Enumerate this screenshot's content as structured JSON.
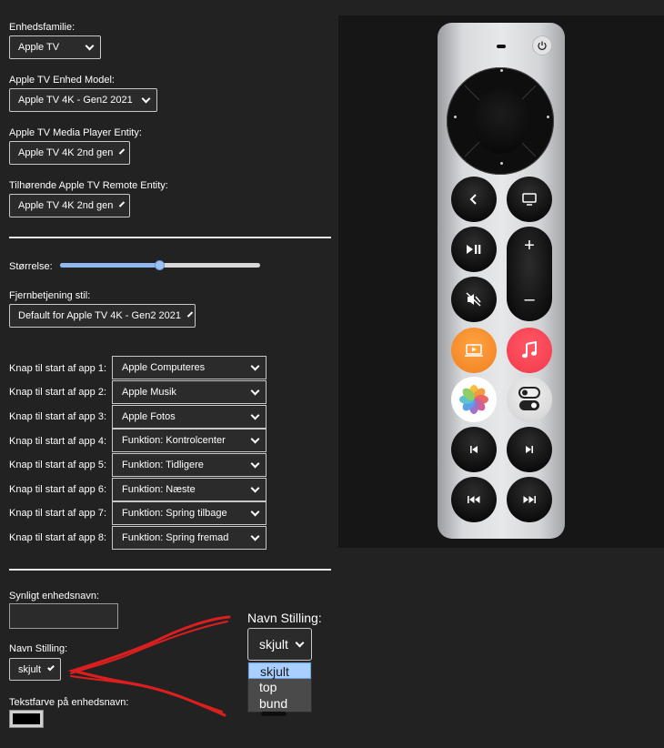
{
  "form": {
    "device_family_label": "Enhedsfamilie:",
    "device_family_value": "Apple TV",
    "device_model_label": "Apple TV Enhed Model:",
    "device_model_value": "Apple TV 4K - Gen2 2021",
    "media_player_label": "Apple TV Media Player Entity:",
    "media_player_value": "Apple TV 4K 2nd gen",
    "remote_entity_label": "Tilhørende Apple TV Remote Entity:",
    "remote_entity_value": "Apple TV 4K 2nd gen",
    "size_label": "Størrelse:",
    "size_value": 0.5,
    "style_label": "Fjernbetjening stil:",
    "style_value": "Default for Apple TV 4K - Gen2 2021",
    "app_buttons": [
      {
        "label": "Knap til start af app 1:",
        "value": "Apple Computeres"
      },
      {
        "label": "Knap til start af app 2:",
        "value": "Apple Musik"
      },
      {
        "label": "Knap til start af app 3:",
        "value": "Apple Fotos"
      },
      {
        "label": "Knap til start af app 4:",
        "value": "Funktion: Kontrolcenter"
      },
      {
        "label": "Knap til start af app 5:",
        "value": "Funktion: Tidligere"
      },
      {
        "label": "Knap til start af app 6:",
        "value": "Funktion: Næste"
      },
      {
        "label": "Knap til start af app 7:",
        "value": "Funktion: Spring tilbage"
      },
      {
        "label": "Knap til start af app 8:",
        "value": "Funktion: Spring fremad"
      }
    ],
    "visible_name_label": "Synligt enhedsnavn:",
    "visible_name_value": "",
    "name_position_label": "Navn Stilling:",
    "name_position_value": "skjult",
    "text_color_label": "Tekstfarve på enhedsnavn:",
    "text_color_value": "#000000"
  },
  "popup": {
    "label": "Navn Stilling:",
    "value": "skjult",
    "options": [
      "skjult",
      "top",
      "bund"
    ]
  },
  "remote": {
    "icons": [
      "power-icon",
      "back-chevron-icon",
      "tv-icon",
      "play-pause-icon",
      "volume-up-icon",
      "mute-icon",
      "volume-down-icon",
      "apple-tv-app-icon",
      "apple-music-icon",
      "photos-icon",
      "control-center-icon",
      "previous-track-icon",
      "next-track-icon",
      "rewind-icon",
      "fast-forward-icon"
    ],
    "plus": "+",
    "minus": "–"
  },
  "colors": {
    "background": "#222222",
    "annotation": "#dd1e1e",
    "orange_app": "#f58a2a",
    "music_app": "#f5404f"
  }
}
